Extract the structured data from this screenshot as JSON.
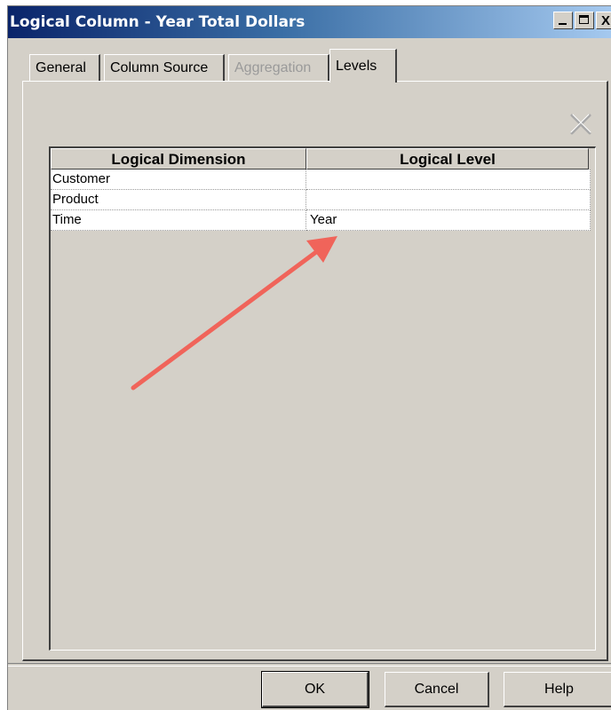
{
  "window": {
    "title": "Logical Column - Year Total Dollars",
    "close_glyph": "X"
  },
  "tabs": [
    {
      "label": "General",
      "state": "normal"
    },
    {
      "label": "Column Source",
      "state": "normal"
    },
    {
      "label": "Aggregation",
      "state": "disabled"
    },
    {
      "label": "Levels",
      "state": "active"
    }
  ],
  "toolbar": {
    "delete_icon": "delete-x-icon"
  },
  "grid": {
    "columns": [
      "Logical Dimension",
      "Logical Level"
    ],
    "rows": [
      {
        "dimension": "Customer",
        "level": ""
      },
      {
        "dimension": "Product",
        "level": ""
      },
      {
        "dimension": "Time",
        "level": "Year"
      }
    ]
  },
  "buttons": {
    "ok": "OK",
    "cancel": "Cancel",
    "help": "Help"
  },
  "colors": {
    "dialog_bg": "#d4d0c8",
    "title_gradient_start": "#0a246a",
    "title_gradient_end": "#a6caf0",
    "annotation_arrow": "#f0645a"
  }
}
